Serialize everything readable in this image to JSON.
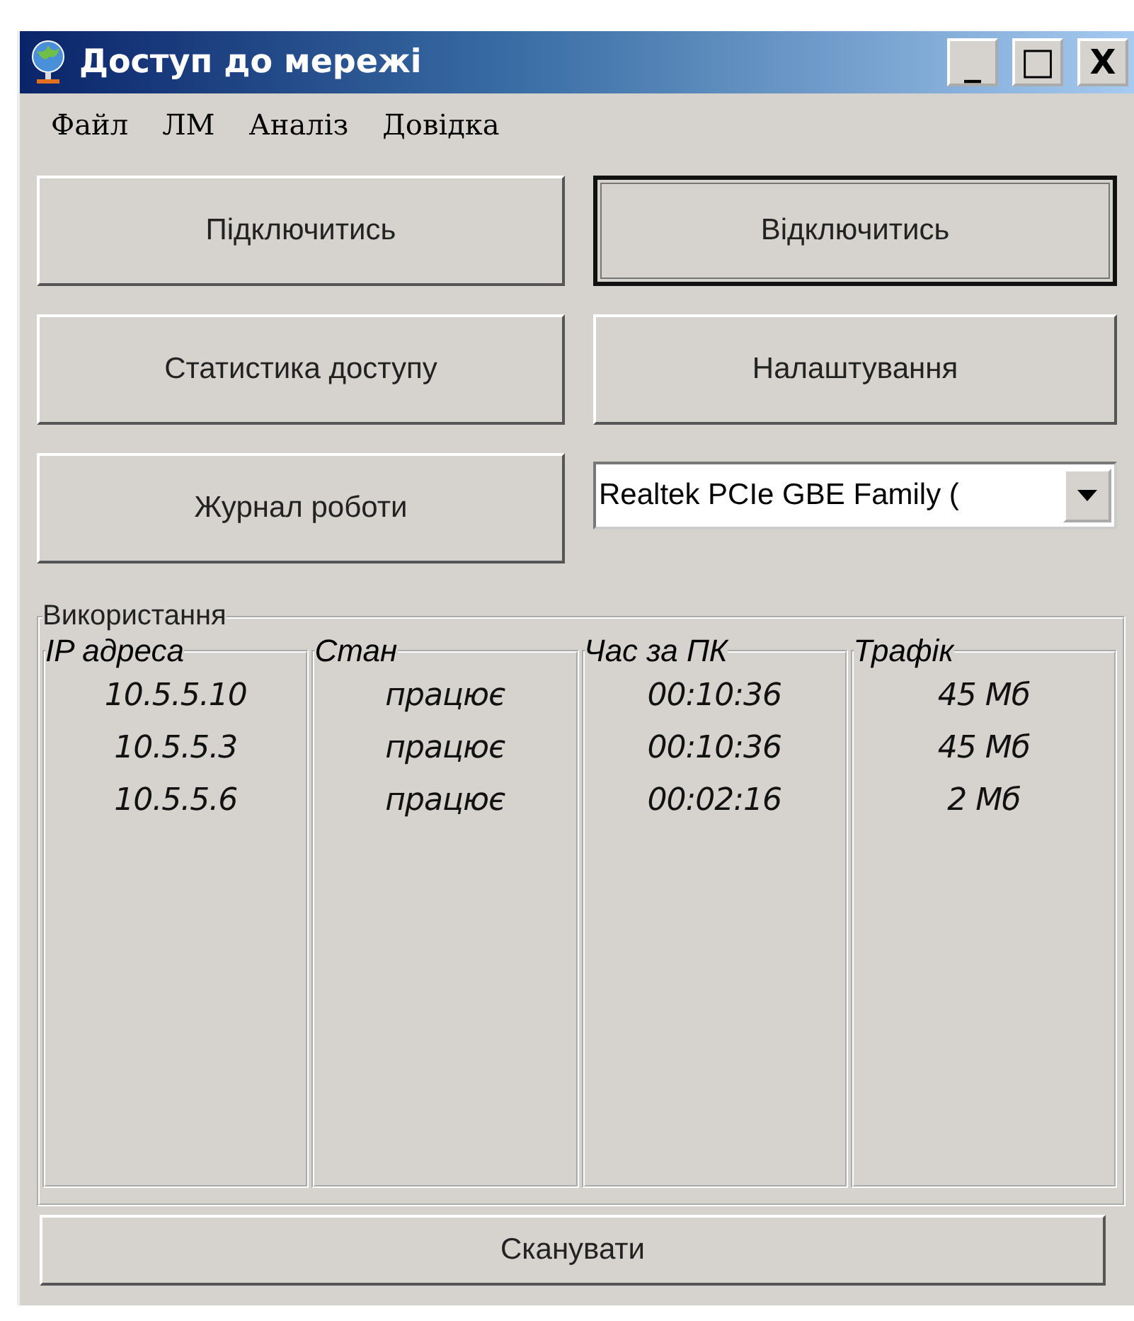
{
  "window": {
    "title": "Доступ до мережі"
  },
  "window_controls": [
    {
      "label": "_",
      "kind": "minimize"
    },
    {
      "label": "□",
      "kind": "maximize"
    },
    {
      "label": "X",
      "kind": "close"
    }
  ],
  "menu": [
    "Файл",
    "ЛМ",
    "Аналіз",
    "Довідка"
  ],
  "buttons": [
    {
      "label": "Підключитись",
      "focused": false
    },
    {
      "label": "Відключитись",
      "focused": true
    },
    {
      "label": "Статистика доступу",
      "focused": false
    },
    {
      "label": "Налаштування",
      "focused": false
    },
    {
      "label": "Журнал роботи",
      "focused": false
    }
  ],
  "adapter_dropdown": {
    "value": "Realtek PCIe GBE Family ("
  },
  "usage": {
    "title": "Використання",
    "columns": [
      {
        "header": "IP адреса",
        "values": [
          "10.5.5.10",
          "10.5.5.3",
          "10.5.5.6"
        ]
      },
      {
        "header": "Стан",
        "values": [
          "працює",
          "працює",
          "працює"
        ]
      },
      {
        "header": "Час за ПК",
        "values": [
          "00:10:36",
          "00:10:36",
          "00:02:16"
        ]
      },
      {
        "header": "Трафік",
        "values": [
          "45 Мб",
          "45 Мб",
          "2 Мб"
        ]
      }
    ]
  },
  "scan_button": {
    "label": "Сканувати"
  }
}
